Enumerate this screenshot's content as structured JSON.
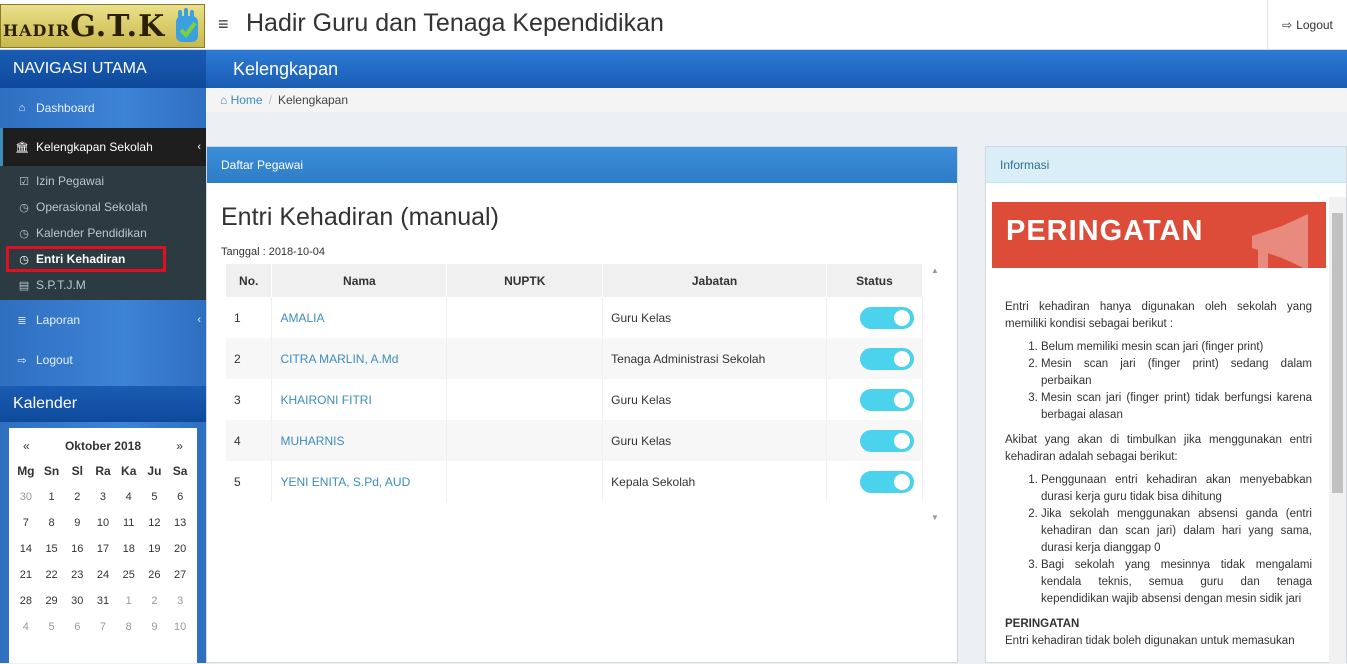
{
  "topbar": {
    "logo_big": "G.T.K",
    "logo_small": "HADIR",
    "menu_icon": "≡",
    "title": "Hadir Guru dan Tenaga Kependidikan",
    "logout_icon": "⇨",
    "logout_label": "Logout"
  },
  "sidebar": {
    "nav_header": "NAVIGASI UTAMA",
    "items": [
      {
        "icon": "⌂",
        "label": "Dashboard"
      },
      {
        "icon": "🏛",
        "label": "Kelengkapan Sekolah",
        "chevron": "‹"
      },
      {
        "icon": "≣",
        "label": "Laporan",
        "chevron": "‹"
      },
      {
        "icon": "⇨",
        "label": "Logout"
      }
    ],
    "sub_items": [
      {
        "icon": "☑",
        "label": "Izin Pegawai"
      },
      {
        "icon": "◷",
        "label": "Operasional Sekolah"
      },
      {
        "icon": "◷",
        "label": "Kalender Pendidikan"
      },
      {
        "icon": "◷",
        "label": "Entri Kehadiran"
      },
      {
        "icon": "▤",
        "label": "S.P.T.J.M"
      }
    ],
    "calendar_header": "Kalender"
  },
  "calendar": {
    "prev": "«",
    "next": "»",
    "month": "Oktober 2018",
    "dows": [
      "Mg",
      "Sn",
      "Sl",
      "Ra",
      "Ka",
      "Ju",
      "Sa"
    ],
    "days": [
      "30",
      "1",
      "2",
      "3",
      "4",
      "5",
      "6",
      "7",
      "8",
      "9",
      "10",
      "11",
      "12",
      "13",
      "14",
      "15",
      "16",
      "17",
      "18",
      "19",
      "20",
      "21",
      "22",
      "23",
      "24",
      "25",
      "26",
      "27",
      "28",
      "29",
      "30",
      "31",
      "1",
      "2",
      "3",
      "4",
      "5",
      "6",
      "7",
      "8",
      "9",
      "10"
    ]
  },
  "content": {
    "header": "Kelengkapan",
    "breadcrumb_home": "Home",
    "breadcrumb_sep": "/",
    "breadcrumb_current": "Kelengkapan"
  },
  "left_panel": {
    "heading": "Daftar Pegawai",
    "title": "Entri Kehadiran (manual)",
    "tanggal": "Tanggal : 2018-10-04",
    "columns": [
      "No.",
      "Nama",
      "NUPTK",
      "Jabatan",
      "Status"
    ],
    "rows": [
      {
        "no": "1",
        "nama": "AMALIA",
        "nuptk": "",
        "jabatan": "Guru Kelas"
      },
      {
        "no": "2",
        "nama": "CITRA MARLIN, A.Md",
        "nuptk": "",
        "jabatan": "Tenaga Administrasi Sekolah"
      },
      {
        "no": "3",
        "nama": "KHAIRONI FITRI",
        "nuptk": "",
        "jabatan": "Guru Kelas"
      },
      {
        "no": "4",
        "nama": "MUHARNIS",
        "nuptk": "",
        "jabatan": "Guru Kelas"
      },
      {
        "no": "5",
        "nama": "YENI ENITA, S.Pd, AUD",
        "nuptk": "",
        "jabatan": "Kepala Sekolah"
      }
    ]
  },
  "right_panel": {
    "heading": "Informasi",
    "warning_title": "PERINGATAN",
    "intro": "Entri kehadiran hanya digunakan oleh sekolah yang memiliki kondisi sebagai berikut :",
    "conditions": [
      "Belum memiliki mesin scan jari (finger print)",
      "Mesin scan jari (finger print) sedang dalam perbaikan",
      "Mesin scan jari (finger print) tidak berfungsi karena berbagai alasan"
    ],
    "effects_intro": "Akibat yang akan di timbulkan jika menggunakan entri kehadiran adalah sebagai berikut:",
    "effects": [
      "Penggunaan entri kehadiran akan menyebabkan durasi kerja guru tidak bisa dihitung",
      "Jika sekolah menggunakan absensi ganda (entri kehadiran dan scan jari) dalam hari yang sama, durasi kerja dianggap 0",
      "Bagi sekolah yang mesinnya tidak mengalami kendala teknis, semua guru dan tenaga kependidikan wajib absensi dengan mesin sidik jari"
    ],
    "peringatan_label": "PERINGATAN",
    "peringatan_text": "Entri kehadiran tidak boleh digunakan untuk memasukan"
  }
}
